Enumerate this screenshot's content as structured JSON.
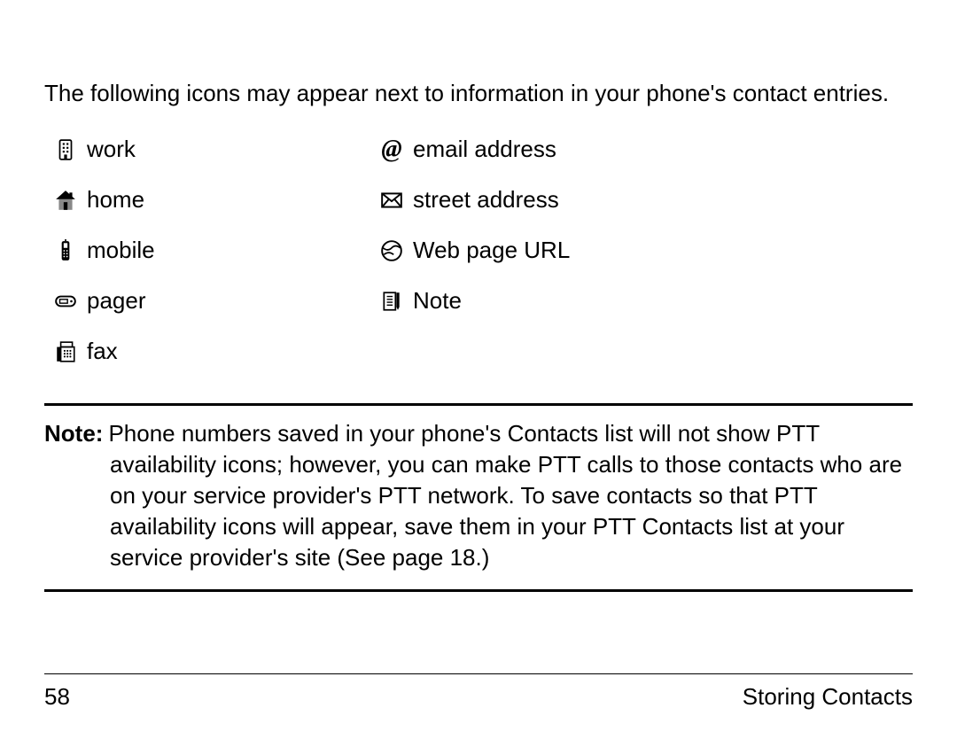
{
  "intro": "The following icons may appear next to information in your phone's contact entries.",
  "iconsLeft": [
    {
      "label": "work"
    },
    {
      "label": "home"
    },
    {
      "label": "mobile"
    },
    {
      "label": "pager"
    },
    {
      "label": "fax"
    }
  ],
  "iconsRight": [
    {
      "label": "email address"
    },
    {
      "label": "street address"
    },
    {
      "label": "Web page URL"
    },
    {
      "label": "Note"
    }
  ],
  "note": {
    "label": "Note:",
    "text_line1": "Phone numbers saved in your phone's Contacts list will not show PTT",
    "text_rest": "availability icons; however, you can make PTT calls to those contacts who are on your service provider's PTT network. To save contacts so that PTT availability icons will appear, save them in your PTT Contacts list at your service provider's site (See page 18.)"
  },
  "footer": {
    "page": "58",
    "section": "Storing Contacts"
  }
}
